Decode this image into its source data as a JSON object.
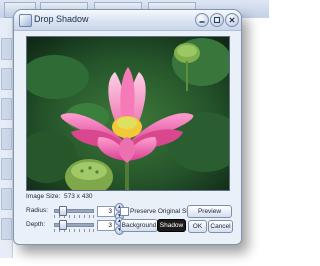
{
  "window": {
    "title": "Drop Shadow"
  },
  "image_info": {
    "size_label": "Image Size:",
    "size_value": "573 x 430"
  },
  "controls": {
    "radius_label": "Radius:",
    "radius_value": "3",
    "depth_label": "Depth:",
    "depth_value": "3",
    "preserve_label": "Preserve Original Size",
    "preserve_checked": false,
    "preview_button": "Preview",
    "background_button": "Background",
    "shadow_button": "Shadow",
    "ok_button": "OK",
    "cancel_button": "Cancel"
  },
  "colors": {
    "dialog_bg": "#eaf0f8",
    "shadow_button_bg": "#1b1b1b",
    "lotus_pink": "#e15aa3"
  },
  "icons": [
    "window-app-icon",
    "minimize-icon",
    "maximize-icon",
    "close-icon",
    "spin-up-icon",
    "spin-down-icon"
  ]
}
